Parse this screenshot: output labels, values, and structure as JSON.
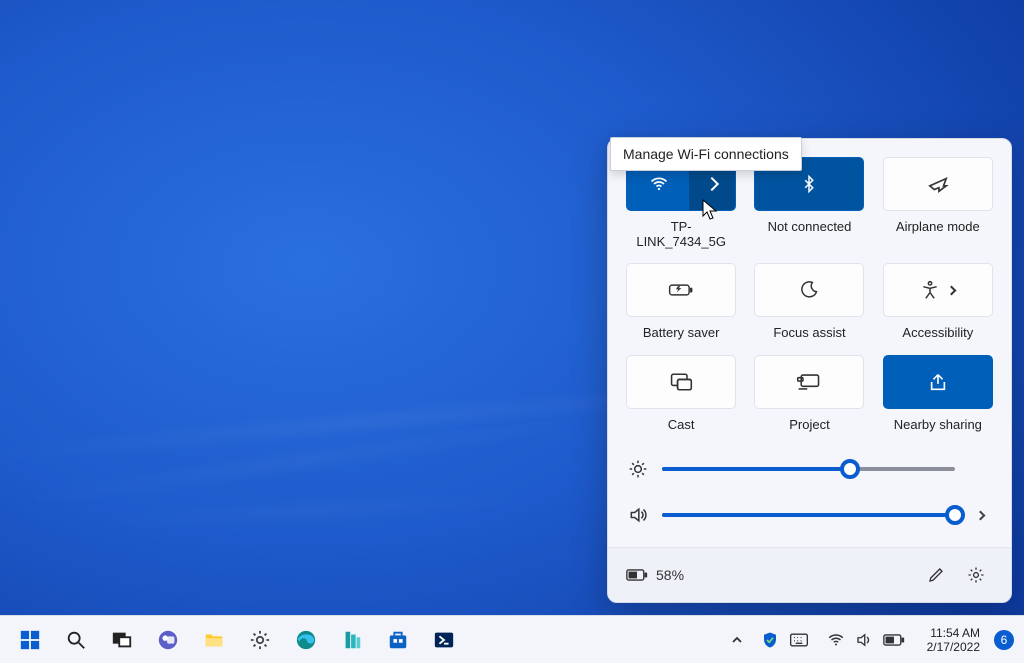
{
  "tooltip": {
    "text": "Manage Wi-Fi connections"
  },
  "tiles": {
    "wifi": {
      "label": "TP-LINK_7434_5G",
      "active": true
    },
    "bluetooth": {
      "label": "Not connected",
      "active": true
    },
    "airplane": {
      "label": "Airplane mode",
      "active": false
    },
    "battery": {
      "label": "Battery saver",
      "active": false
    },
    "focus": {
      "label": "Focus assist",
      "active": false
    },
    "access": {
      "label": "Accessibility",
      "active": false
    },
    "cast": {
      "label": "Cast",
      "active": false
    },
    "project": {
      "label": "Project",
      "active": false
    },
    "nearby": {
      "label": "Nearby sharing",
      "active": true
    }
  },
  "sliders": {
    "brightness": {
      "value": 64
    },
    "volume": {
      "value": 100
    }
  },
  "panel_footer": {
    "battery_pct": "58%"
  },
  "taskbar": {
    "time": "11:54 AM",
    "date": "2/17/2022",
    "notif_count": "6"
  }
}
